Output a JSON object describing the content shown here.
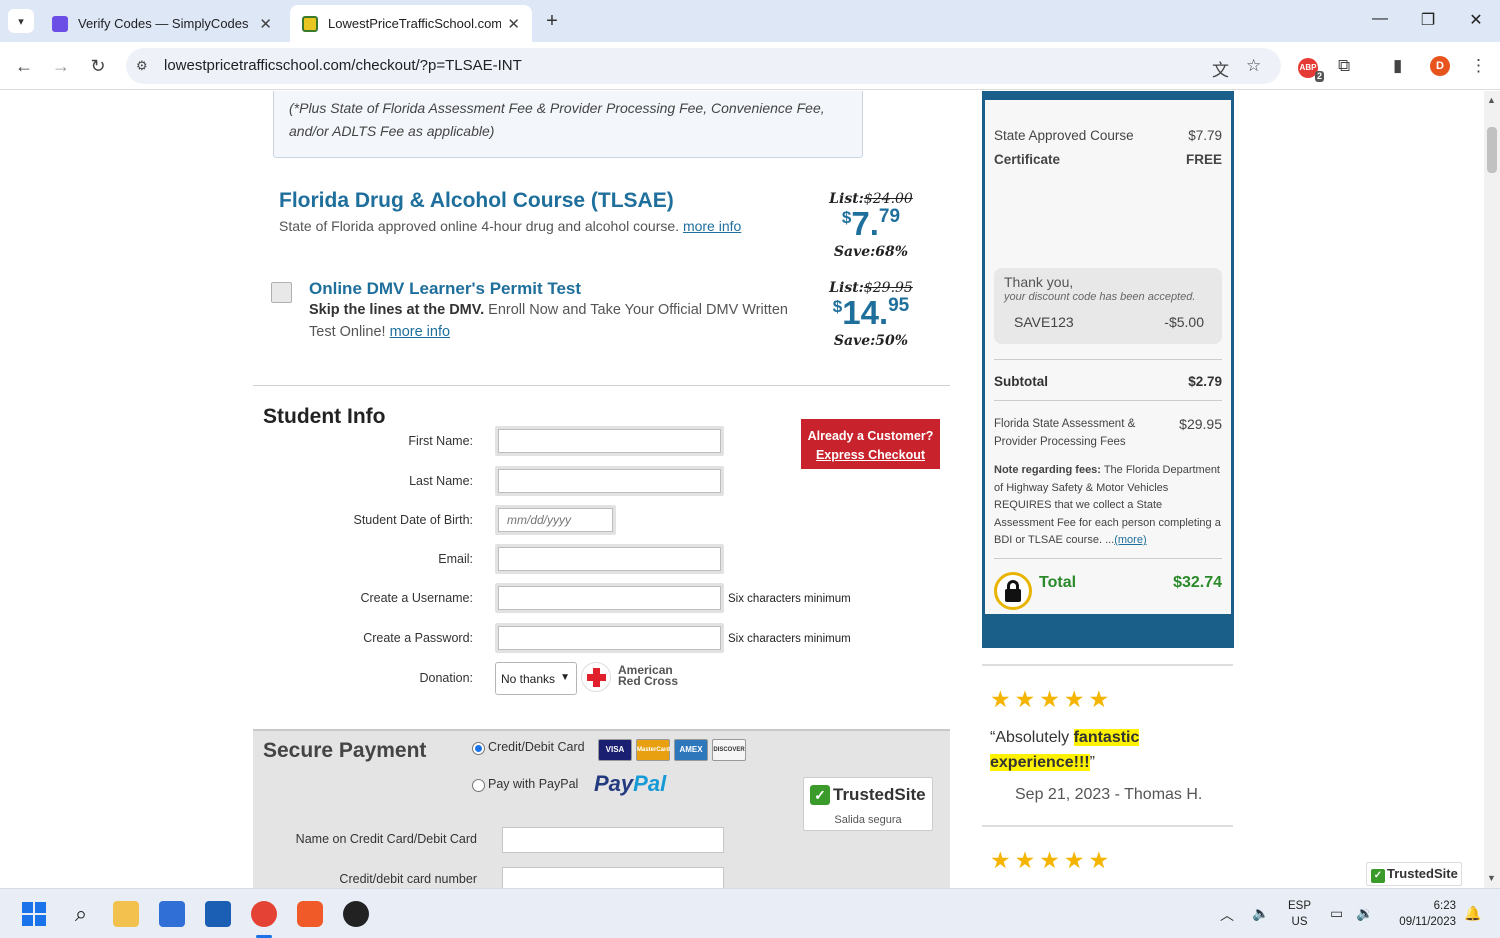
{
  "browser": {
    "tabs": [
      {
        "title": "Verify Codes — SimplyCodes"
      },
      {
        "title": "LowestPriceTrafficSchool.com"
      }
    ],
    "url": "lowestpricetrafficschool.com/checkout/?p=TLSAE-INT",
    "profile_initial": "D",
    "extension_badge": "ABP",
    "extension_count": "2"
  },
  "fee_note": "(*Plus State of Florida Assessment Fee & Provider Processing Fee, Convenience Fee, and/or ADLTS Fee as applicable)",
  "course": {
    "title": "Florida Drug & Alcohol Course (TLSAE)",
    "description": "State of Florida approved online 4-hour drug and alcohol course.",
    "more_info": "more info",
    "list_label": "List:",
    "list_price": "$24.00",
    "price_dollars": "7",
    "price_cents": "79",
    "save_label": "Save:68%"
  },
  "addon": {
    "title": "Online DMV Learner's Permit Test",
    "desc_bold": "Skip the lines at the DMV.",
    "desc_rest": "Enroll Now and Take Your Official DMV Written Test Online!",
    "more_info": "more info",
    "list_label": "List:",
    "list_price": "$29.95",
    "price_dollars": "14",
    "price_cents": "95",
    "save_label": "Save:50%"
  },
  "student_info": {
    "title": "Student Info",
    "first_name_label": "First Name:",
    "last_name_label": "Last Name:",
    "dob_label": "Student Date of Birth:",
    "dob_placeholder": "mm/dd/yyyy",
    "email_label": "Email:",
    "username_label": "Create a Username:",
    "password_label": "Create a Password:",
    "min_hint": "Six characters minimum",
    "donation_label": "Donation:",
    "donation_value": "No thanks",
    "red_cross_line1": "American",
    "red_cross_line2": "Red Cross"
  },
  "express": {
    "line1": "Already a Customer?",
    "line2": "Express Checkout"
  },
  "payment": {
    "title": "Secure Payment",
    "credit_label": "Credit/Debit Card",
    "paypal_label": "Pay with PayPal",
    "paypal_logo_a": "Pay",
    "paypal_logo_b": "Pal",
    "cards": [
      "VISA",
      "MasterCard",
      "AMEX",
      "DISCOVER"
    ],
    "trusted_logo": "TrustedSite",
    "trusted_sub": "Salida segura",
    "name_label": "Name on Credit Card/Debit Card",
    "number_label": "Credit/debit card number"
  },
  "summary": {
    "course_label": "State Approved Course",
    "course_price": "$7.79",
    "certificate_label": "Certificate",
    "certificate_price": "FREE",
    "thanks": "Thank you,",
    "accepted": "your discount code has been accepted.",
    "code": "SAVE123",
    "discount": "-$5.00",
    "subtotal_label": "Subtotal",
    "subtotal": "$2.79",
    "fees_label": "Florida State Assessment & Provider Processing Fees",
    "fees": "$29.95",
    "note_bold": "Note regarding fees:",
    "note_text": "The Florida Department of Highway Safety & Motor Vehicles REQUIRES that we collect a State Assessment Fee for each person completing a BDI or TLSAE course. ...",
    "more": "(more)",
    "total_label": "Total",
    "total": "$32.74"
  },
  "review": {
    "stars": "★★★★★",
    "quote_open": "“Absolutely ",
    "quote_highlight": "fantastic experience!!!",
    "quote_close": "”",
    "meta": "Sep 21, 2023 - Thomas H."
  },
  "trusted_badge": "TrustedSite",
  "taskbar": {
    "lang1": "ESP",
    "lang2": "US",
    "time": "6:23",
    "date": "09/11/2023"
  }
}
